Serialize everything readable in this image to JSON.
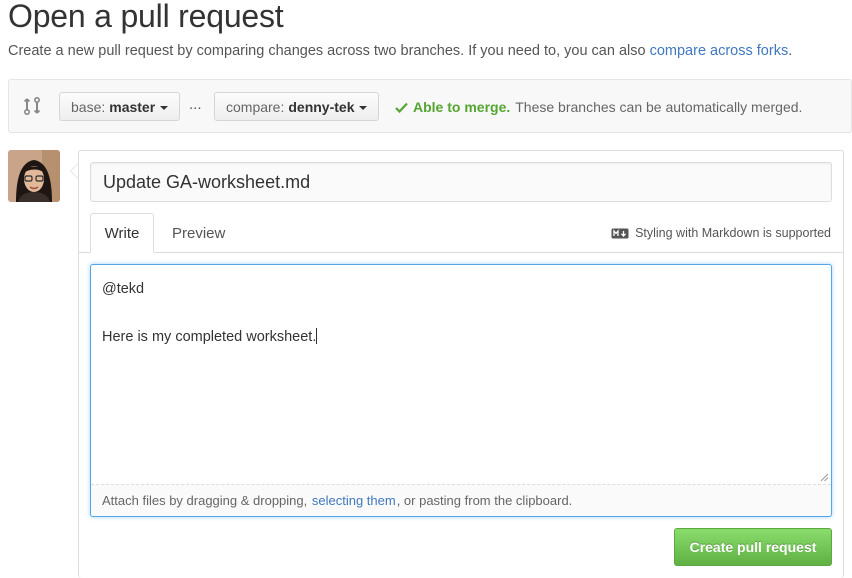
{
  "header": {
    "title": "Open a pull request",
    "subtitle_text": "Create a new pull request by comparing changes across two branches. If you need to, you can also",
    "subtitle_link": "compare across forks",
    "subtitle_end": "."
  },
  "range": {
    "base_prefix": "base:",
    "base_branch": "master",
    "separator": "...",
    "compare_prefix": "compare:",
    "compare_branch": "denny-tek",
    "merge_status": "Able to merge.",
    "merge_detail": "These branches can be automatically merged."
  },
  "form": {
    "title_value": "Update GA-worksheet.md",
    "tabs": [
      {
        "label": "Write",
        "active": true
      },
      {
        "label": "Preview",
        "active": false
      }
    ],
    "markdown_hint": "Styling with Markdown is supported",
    "comment_line1": "@tekd",
    "comment_line2": "Here is my completed worksheet.",
    "attach_pre": "Attach files by dragging & dropping,",
    "attach_link": "selecting them",
    "attach_post": ", or pasting from the clipboard.",
    "submit_label": "Create pull request"
  },
  "colors": {
    "link": "#4078c0",
    "success": "#55a532",
    "button_green": "#60b044",
    "focus_blue": "#51a7e8"
  },
  "icons": [
    "git-compare-icon",
    "caret-down-icon",
    "check-icon",
    "markdown-icon",
    "resize-grip-icon"
  ]
}
